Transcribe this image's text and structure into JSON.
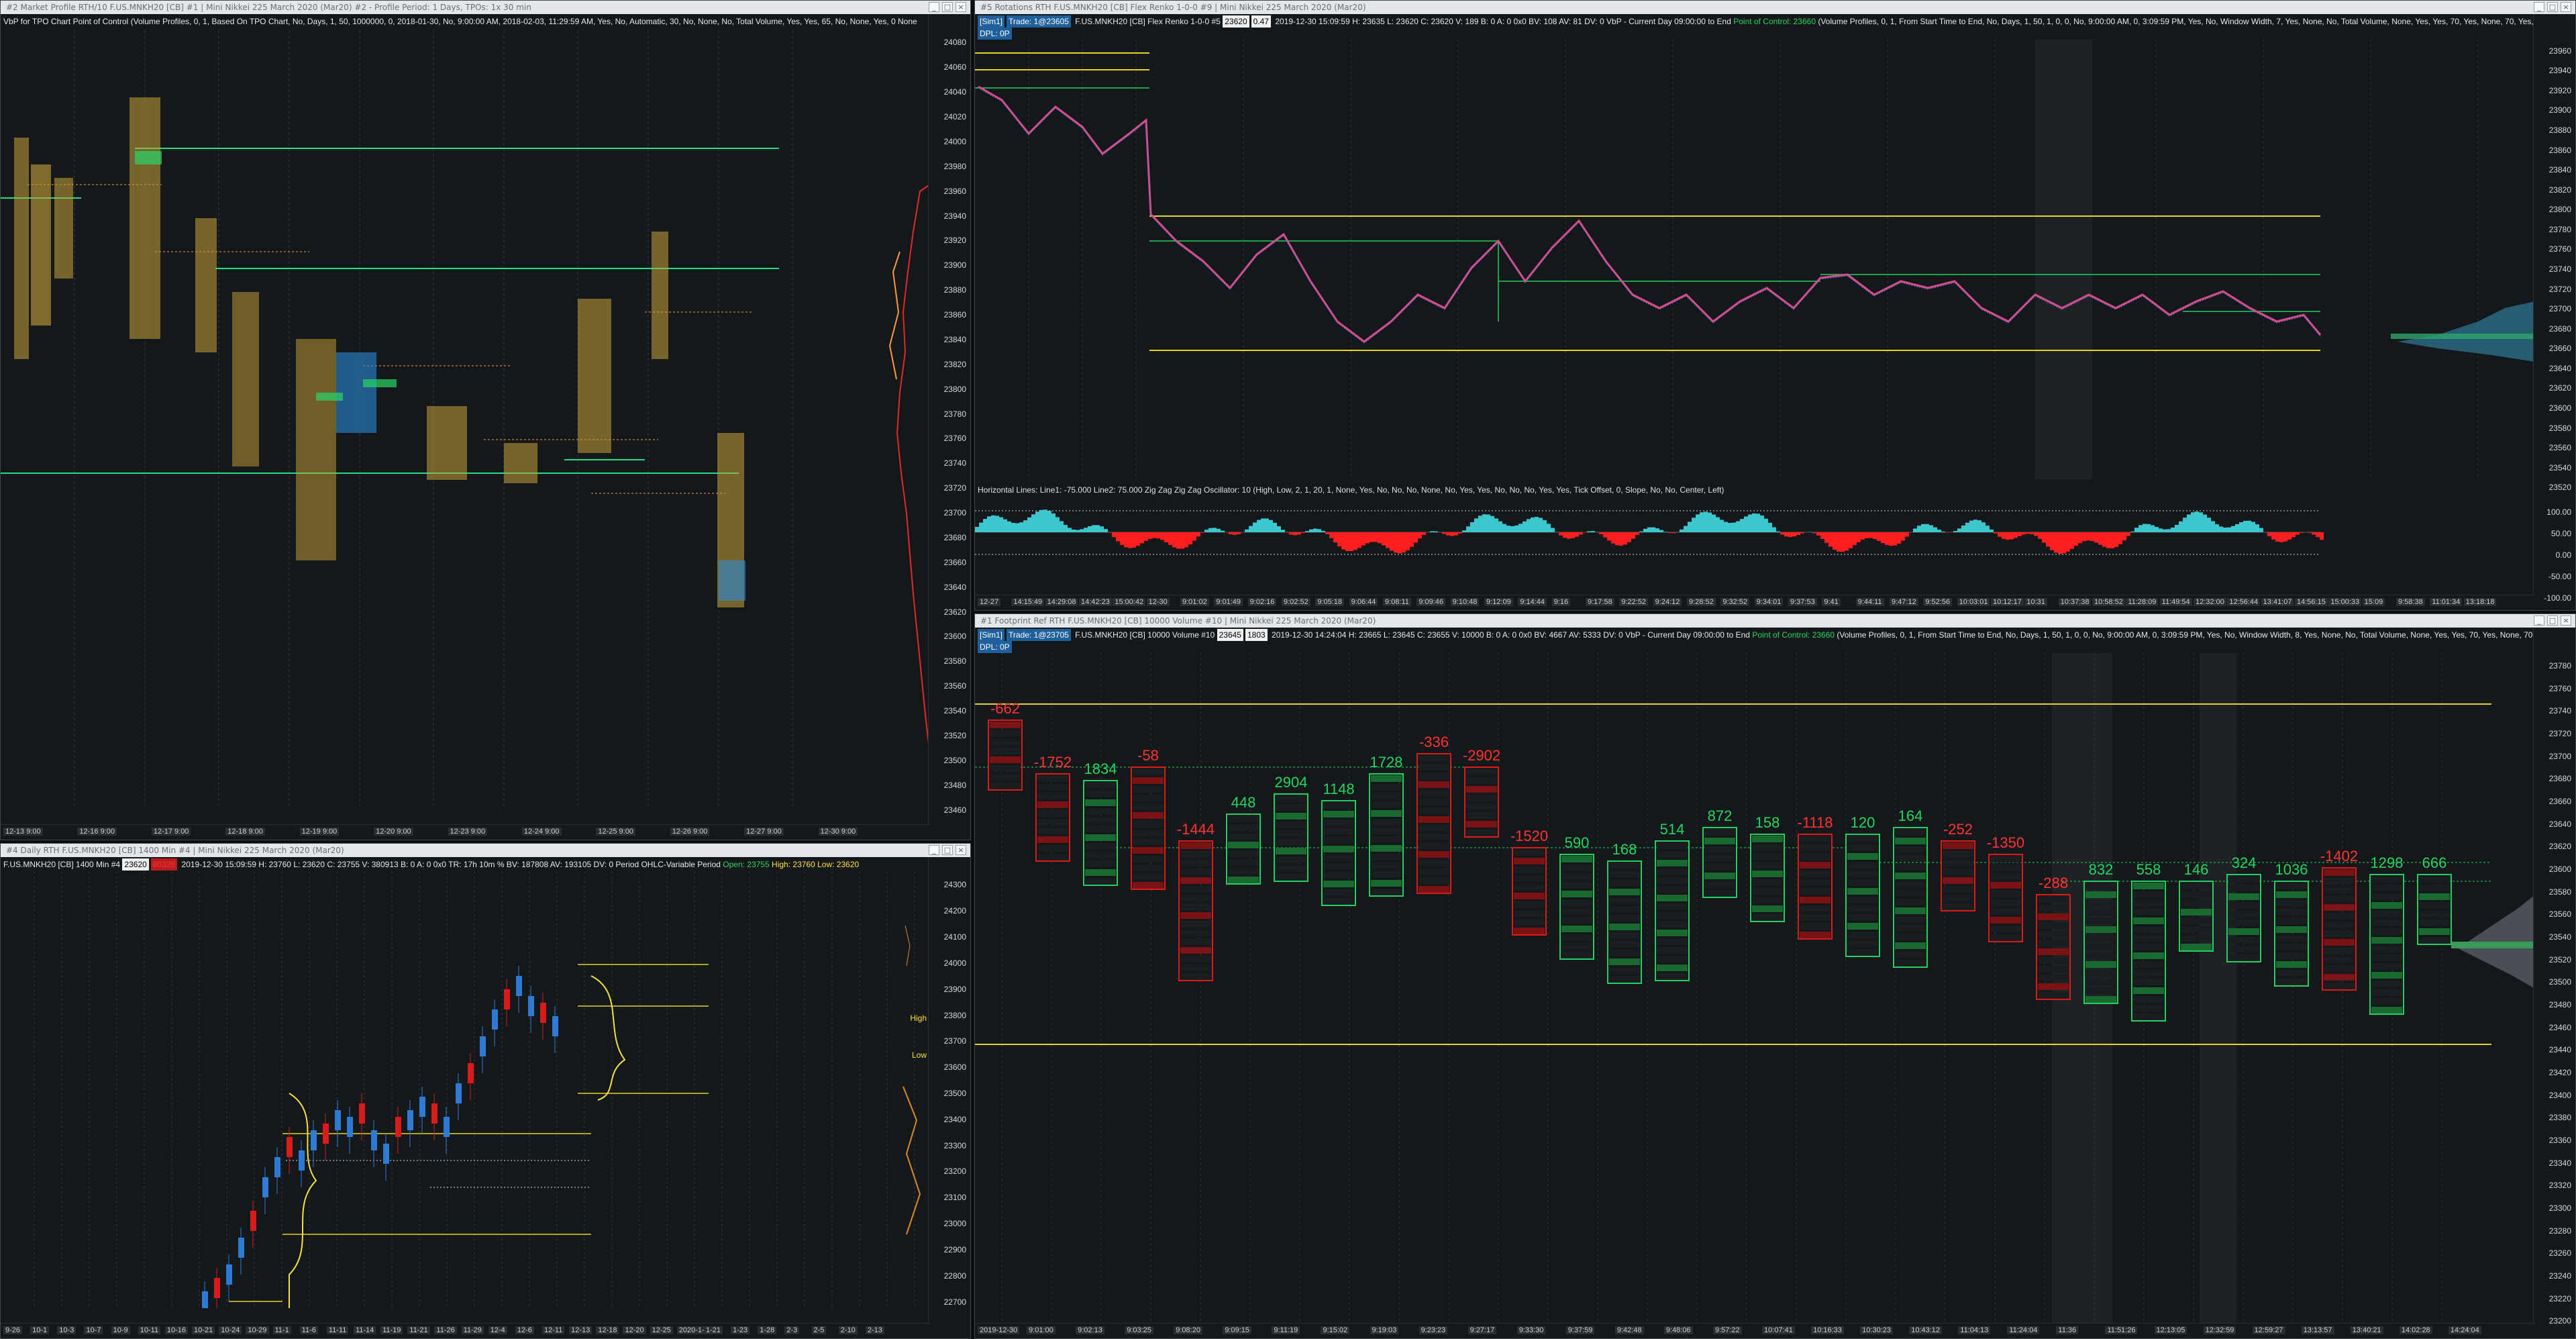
{
  "colors": {
    "background": "#0b0c0d",
    "panel": "#15181b",
    "green": "#1ed760",
    "red": "#ff3434",
    "yellow": "#ffe033",
    "cyan": "#3ec6cf",
    "blue": "#2e7bd6"
  },
  "windows": {
    "tl": {
      "title": "#2 Market Profile  RTH/10  F.US.MNKH20 [CB]  #1 | Mini Nikkei 225 March 2020 (Mar20)  #2 - Profile Period: 1 Days, TPOs: 1x 30 min",
      "info": "VbP for TPO Chart  Point of Control  (Volume Profiles, 0, 1, Based On TPO Chart, No, Days, 1, 50, 1000000, 0, 2018-01-30, No, 9:00:00 AM, 2018-02-03, 11:29:59 AM, Yes, No, Automatic, 30, No, None, No, Total Volume, Yes, Yes, 65, No, None, Yes, 0 None",
      "y_labels": [
        "24080",
        "24060",
        "24040",
        "24020",
        "24000",
        "23980",
        "23960",
        "23940",
        "23920",
        "23900",
        "23880",
        "23860",
        "23840",
        "23820",
        "23800",
        "23780",
        "23760",
        "23740",
        "23720",
        "23700",
        "23680",
        "23660",
        "23640",
        "23620",
        "23600",
        "23580",
        "23560",
        "23540",
        "23520",
        "23500",
        "23480",
        "23460"
      ],
      "x_labels": [
        "12-13 9:00",
        "12-16 9:00",
        "12-17 9:00",
        "12-18 9:00",
        "12-19 9:00",
        "12-20 9:00",
        "12-23 9:00",
        "12-24 9:00",
        "12-25 9:00",
        "12-26 9:00",
        "12-27 9:00",
        "12-30 9:00"
      ]
    },
    "tr": {
      "title": "#5 Rotations RTH  F.US.MNKH20 [CB]  Flex Renko 1-0-0  #9 | Mini Nikkei 225 March 2020 (Mar20)",
      "sim": "[Sim1]",
      "trade": "Trade: 1@23605",
      "info1": "F.US.MNKH20 [CB]  Flex Renko 1-0-0  #5",
      "qty": "23620",
      "chg": "0.47",
      "info2": "2019-12-30 15:09:59 H: 23635 L: 23620 C: 23620 V: 189 B: 0 A: 0 0x0 BV: 108 AV: 81 DV: 0 VbP - Current Day 09:00:00 to End",
      "poc": "Point of Control: 23660",
      "info3": "(Volume Profiles, 0, 1, From Start Time to End, No, Days, 1, 50, 1, 0, 0, No, 9:00:00 AM, 0, 3:09:59 PM, Yes, No, Window Width, 7, Yes, None, No, Total Volume, None, Yes, Yes, 70, Yes, None, 70, Yes, No",
      "dpl": "DPL: 0P",
      "study": "Horizontal Lines: Line1: -75.000  Line2: 75.000  Zig Zag  Zig Zag Oscillator: 10   (High, Low, 2, 1, 20, 1, None, Yes, No, No, No, None, No, Yes, Yes, No, No, No, Yes, Yes, Tick Offset, 0, Slope, No, No, Center, Left)",
      "y_labels": [
        "23960",
        "23940",
        "23920",
        "23900",
        "23880",
        "23860",
        "23840",
        "23820",
        "23800",
        "23780",
        "23760",
        "23740",
        "23720",
        "23700",
        "23680",
        "23660",
        "23640",
        "23620",
        "23600",
        "23580",
        "23560",
        "23540",
        "23520"
      ],
      "osc_labels": [
        "100.00",
        "50.00",
        "0.00",
        "-50.00",
        "-100.00"
      ],
      "x_labels": [
        "12-27",
        "14:15:49",
        "14:29:08",
        "14:42:23",
        "15:00:42",
        "12-30",
        "9:01:02",
        "9:01:49",
        "9:02:16",
        "9:02:52",
        "9:05:18",
        "9:06:44",
        "9:08:11",
        "9:09:46",
        "9:10:48",
        "9:12:09",
        "9:14:44",
        "9:16",
        "9:17:58",
        "9:22:52",
        "9:24:12",
        "9:28:52",
        "9:32:52",
        "9:34:01",
        "9:37:53",
        "9:41",
        "9:44:11",
        "9:47:12",
        "9:52:56",
        "10:03:01",
        "10:12:17",
        "10:31",
        "10:37:38",
        "10:58:52",
        "11:28:09",
        "11:49:54",
        "12:32:00",
        "12:56:44",
        "13:41:07",
        "14:56:15",
        "15:00:33",
        "15:09",
        "9:58:38",
        "11:01:34",
        "13:18:18"
      ]
    },
    "bl": {
      "title": "#4 Daily  RTH  F.US.MNKH20 [CB]  1400 Min  #4 | Mini Nikkei 225 March 2020 (Mar20)",
      "info1": "F.US.MNKH20 [CB]  1400 Min  #4",
      "qty": "23620",
      "chg": "80328",
      "info2": "2019-12-30 15:09:59 H: 23760 L: 23620 C: 23755 V: 380913 B: 0 A: 0 0x0 TR: 17h 10m  % BV: 187808 AV: 193105 DV: 0 Period OHLC-Variable Period",
      "open": "Open: 23755",
      "high": "High: 23760",
      "low": "Low: 23620",
      "y_labels": [
        "24300",
        "24200",
        "24100",
        "24000",
        "23900",
        "23800",
        "23700",
        "23600",
        "23500",
        "23400",
        "23300",
        "23200",
        "23100",
        "23000",
        "22900",
        "22800",
        "22700"
      ],
      "marker_high": "High",
      "marker_low": "Low",
      "x_labels": [
        "9-26",
        "10-1",
        "10-3",
        "10-7",
        "10-9",
        "10-11",
        "10-16",
        "10-21",
        "10-24",
        "10-29",
        "11-1",
        "11-6",
        "11-11",
        "11-14",
        "11-19",
        "11-21",
        "11-26",
        "11-29",
        "12-4",
        "12-6",
        "12-11",
        "12-13",
        "12-18",
        "12-20",
        "12-25",
        "2020-1-15",
        "1-21",
        "1-23",
        "1-28",
        "2-3",
        "2-5",
        "2-10",
        "2-13"
      ]
    },
    "br": {
      "title": "#1 Footprint Ref  RTH  F.US.MNKH20 [CB]  10000 Volume  #10 | Mini Nikkei 225 March 2020 (Mar20)",
      "sim": "[Sim1]",
      "trade": "Trade: 1@23705",
      "info1": "F.US.MNKH20 [CB]  10000 Volume  #10",
      "qty": "23645",
      "chg": "1803",
      "info2": "2019-12-30 14:24:04 H: 23665 L: 23645 C: 23655 V: 10000 B: 0 A: 0 0x0 BV: 4667 AV: 5333 DV: 0 VbP - Current Day 09:00:00 to End",
      "poc": "Point of Control: 23660",
      "info3": "(Volume Profiles, 0, 1, From Start Time to End, No, Days, 1, 50, 1, 0, 0, No, 9:00:00 AM, 0, 3:09:59 PM, Yes, No, Window Width, 8, Yes, None, No, Total Volume, None, Yes, Yes, 70, Yes, None, 70",
      "dpl": "DPL: 0P",
      "y_labels": [
        "23780",
        "23760",
        "23740",
        "23720",
        "23700",
        "23680",
        "23660",
        "23640",
        "23620",
        "23600",
        "23580",
        "23560",
        "23540",
        "23520",
        "23500",
        "23480",
        "23460",
        "23440",
        "23420",
        "23400",
        "23380",
        "23360",
        "23340",
        "23320",
        "23300",
        "23280",
        "23260",
        "23240",
        "23220",
        "23200"
      ],
      "deltas": [
        {
          "v": "-662",
          "c": "red"
        },
        {
          "v": "-1752",
          "c": "red"
        },
        {
          "v": "1834",
          "c": "green"
        },
        {
          "v": "-58",
          "c": "red"
        },
        {
          "v": "-1444",
          "c": "red"
        },
        {
          "v": "448",
          "c": "green"
        },
        {
          "v": "2904",
          "c": "green"
        },
        {
          "v": "1148",
          "c": "green"
        },
        {
          "v": "1728",
          "c": "green"
        },
        {
          "v": "-336",
          "c": "red"
        },
        {
          "v": "-2902",
          "c": "red"
        },
        {
          "v": "-1520",
          "c": "red"
        },
        {
          "v": "590",
          "c": "green"
        },
        {
          "v": "168",
          "c": "green"
        },
        {
          "v": "514",
          "c": "green"
        },
        {
          "v": "872",
          "c": "green"
        },
        {
          "v": "158",
          "c": "green"
        },
        {
          "v": "-1118",
          "c": "red"
        },
        {
          "v": "120",
          "c": "green"
        },
        {
          "v": "164",
          "c": "green"
        },
        {
          "v": "-252",
          "c": "red"
        },
        {
          "v": "-1350",
          "c": "red"
        },
        {
          "v": "-288",
          "c": "red"
        },
        {
          "v": "832",
          "c": "green"
        },
        {
          "v": "558",
          "c": "green"
        },
        {
          "v": "146",
          "c": "green"
        },
        {
          "v": "324",
          "c": "green"
        },
        {
          "v": "1036",
          "c": "green"
        },
        {
          "v": "-1402",
          "c": "red"
        },
        {
          "v": "1298",
          "c": "green"
        },
        {
          "v": "666",
          "c": "green"
        }
      ],
      "x_labels": [
        "2019-12-30",
        "9:01:00",
        "9:02:13",
        "9:03:25",
        "9:08:20",
        "9:09:15",
        "9:11:19",
        "9:15:02",
        "9:19:03",
        "9:23:23",
        "9:27:17",
        "9:33:30",
        "9:37:59",
        "9:42:48",
        "9:48:06",
        "9:57:22",
        "10:07:41",
        "10:16:33",
        "10:30:23",
        "10:43:12",
        "11:04:13",
        "11:24:04",
        "11:36",
        "11:51:26",
        "12:13:05",
        "12:32:59",
        "12:59:27",
        "13:13:57",
        "13:40:21",
        "14:02:28",
        "14:24:04"
      ]
    }
  }
}
